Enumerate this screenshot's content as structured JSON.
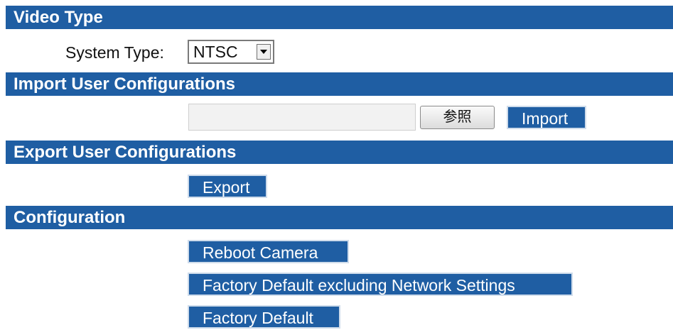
{
  "sections": {
    "video_type": "Video Type",
    "import": "Import User Configurations",
    "export": "Export User Configurations",
    "configuration": "Configuration"
  },
  "video_type": {
    "system_type_label": "System Type:",
    "system_type_value": "NTSC"
  },
  "import": {
    "browse_label": "参照",
    "import_label": "Import"
  },
  "export": {
    "export_label": "Export"
  },
  "configuration": {
    "reboot_label": "Reboot Camera",
    "factory_default_excluding_label": "Factory Default excluding Network Settings",
    "factory_default_label": "Factory Default"
  },
  "colors": {
    "header_bg": "#1f5ea3",
    "header_text": "#ffffff"
  }
}
